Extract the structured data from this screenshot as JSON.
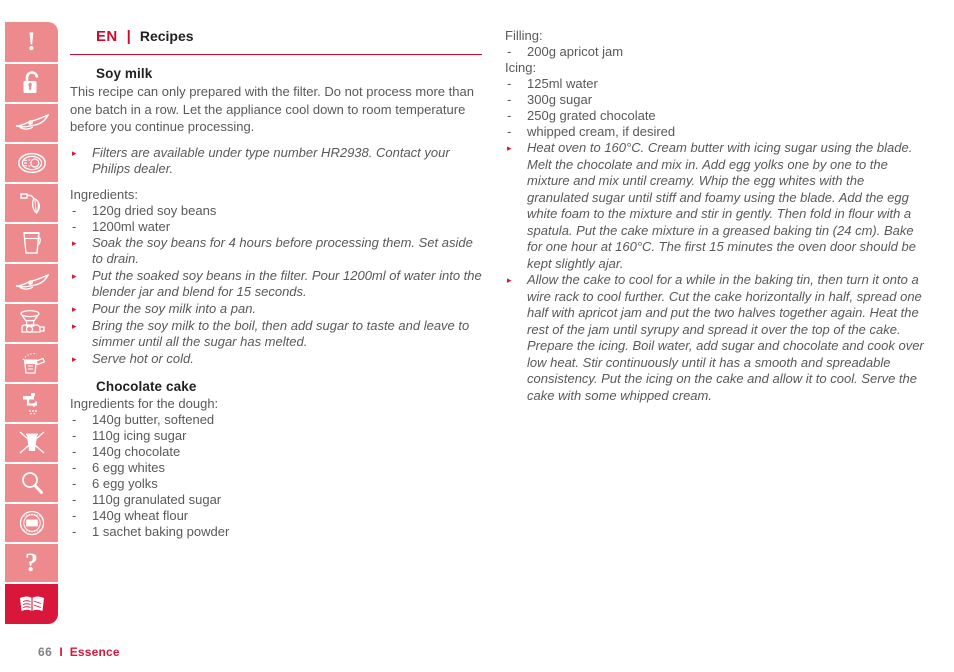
{
  "header": {
    "lang": "EN",
    "separator": "|",
    "title": "Recipes"
  },
  "footer": {
    "page_number": "66",
    "separator": "I",
    "brand": "Essence"
  },
  "sidebar": {
    "items": [
      {
        "name": "warning-exclamation-icon",
        "label": "Important safety information"
      },
      {
        "name": "unlocked-padlock-icon",
        "label": "Safety lock"
      },
      {
        "name": "blade-icon",
        "label": "Blade"
      },
      {
        "name": "disc-insert-icon",
        "label": "Discs and inserts"
      },
      {
        "name": "whisk-icon",
        "label": "Balloon beater / whisk"
      },
      {
        "name": "blender-jar-icon",
        "label": "Blender jar"
      },
      {
        "name": "blade-icon-2",
        "label": "Blade"
      },
      {
        "name": "mincer-icon",
        "label": "Mincer"
      },
      {
        "name": "storage-box-icon",
        "label": "Storage"
      },
      {
        "name": "tap-cleaning-icon",
        "label": "Cleaning"
      },
      {
        "name": "disposal-bin-crossed-icon",
        "label": "Environment / disposal"
      },
      {
        "name": "magnifier-troubleshooting-icon",
        "label": "Troubleshooting"
      },
      {
        "name": "worldwide-guarantee-seal-icon",
        "label": "Guarantee and service"
      },
      {
        "name": "question-mark-icon",
        "label": "Frequently asked questions"
      },
      {
        "name": "recipes-book-icon",
        "label": "Recipes"
      }
    ],
    "active_index": 14
  },
  "left_column": {
    "recipe1": {
      "title": "Soy milk",
      "intro": "This recipe can only prepared with the filter. Do not process more than one batch in a row. Let the appliance cool down to room temperature before you continue processing.",
      "note": "Filters are available under type number HR2938. Contact your Philips dealer.",
      "ingredients_label": "Ingredients:",
      "ingredients": [
        "120g dried soy beans",
        "1200ml water"
      ],
      "steps": [
        "Soak the soy beans for 4 hours before processing them. Set aside to drain.",
        "Put the soaked soy beans in the filter. Pour 1200ml of water into the blender jar and blend for 15 seconds.",
        "Pour the soy milk into a pan.",
        "Bring the soy milk to the boil, then add sugar to taste and leave to simmer until all the sugar has melted.",
        "Serve hot or cold."
      ]
    },
    "recipe2": {
      "title": "Chocolate cake",
      "dough_label": "Ingredients for the dough:",
      "dough_ingredients": [
        "140g butter, softened",
        "110g icing sugar",
        "140g chocolate",
        "6 egg whites",
        "6 egg yolks",
        "110g granulated sugar",
        "140g wheat flour",
        "1 sachet baking powder"
      ]
    }
  },
  "right_column": {
    "filling_label": "Filling:",
    "filling_ingredients": [
      "200g apricot jam"
    ],
    "icing_label": "Icing:",
    "icing_ingredients": [
      "125ml water",
      "300g sugar",
      "250g grated chocolate",
      "whipped cream, if desired"
    ],
    "steps": [
      "Heat oven to 160°C. Cream butter with icing sugar using the blade. Melt the chocolate and mix in. Add egg yolks one by one to the mixture and mix until creamy. Whip the egg whites with the granulated sugar until stiff and foamy using the blade. Add the egg white foam to the mixture and stir in gently. Then fold in flour with a spatula. Put the cake mixture in a greased baking tin (24 cm). Bake for one hour at 160°C. The first 15 minutes the oven door should be kept slightly ajar.",
      "Allow the cake to cool for a while in the baking tin, then turn it onto a wire rack to cool further. Cut the cake horizontally in half, spread one half with apricot jam and put the two halves together again. Heat the rest of the jam until syrupy and spread it over the top of the cake. Prepare the icing. Boil water, add sugar and chocolate and cook over low heat. Stir continuously until it has a smooth and spreadable consistency. Put the icing on the cake and allow it to cool. Serve the cake with some whipped cream."
    ]
  },
  "markers": {
    "dash": "-",
    "triangle": "▸"
  },
  "colors": {
    "brand_red": "#d8173b",
    "header_red": "#cf0a2c",
    "sidebar_pink": "#ec8a8e",
    "body_gray": "#58595b"
  }
}
